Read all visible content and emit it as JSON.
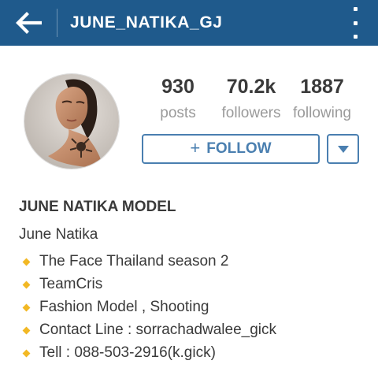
{
  "header": {
    "username": "JUNE_NATIKA_GJ",
    "back_icon": "arrow-left-icon",
    "menu_icon": "more-vertical-icon",
    "background_color": "#1f5a8c"
  },
  "profile": {
    "stats": [
      {
        "value": "930",
        "label": "posts"
      },
      {
        "value": "70.2k",
        "label": "followers"
      },
      {
        "value": "1887",
        "label": "following"
      }
    ],
    "follow_label": "FOLLOW",
    "follow_icon": "plus-icon",
    "dropdown_icon": "caret-down-icon",
    "accent_color": "#4a7fb0"
  },
  "bio": {
    "full_name": "JUNE NATIKA MODEL",
    "name_line": "June Natika",
    "bullet_color": "#f2b824",
    "items": [
      "The Face Thailand season 2",
      "TeamCris",
      "Fashion Model , Shooting",
      "Contact Line : sorrachadwalee_gick",
      "Tell : 088-503-2916(k.gick)"
    ]
  }
}
